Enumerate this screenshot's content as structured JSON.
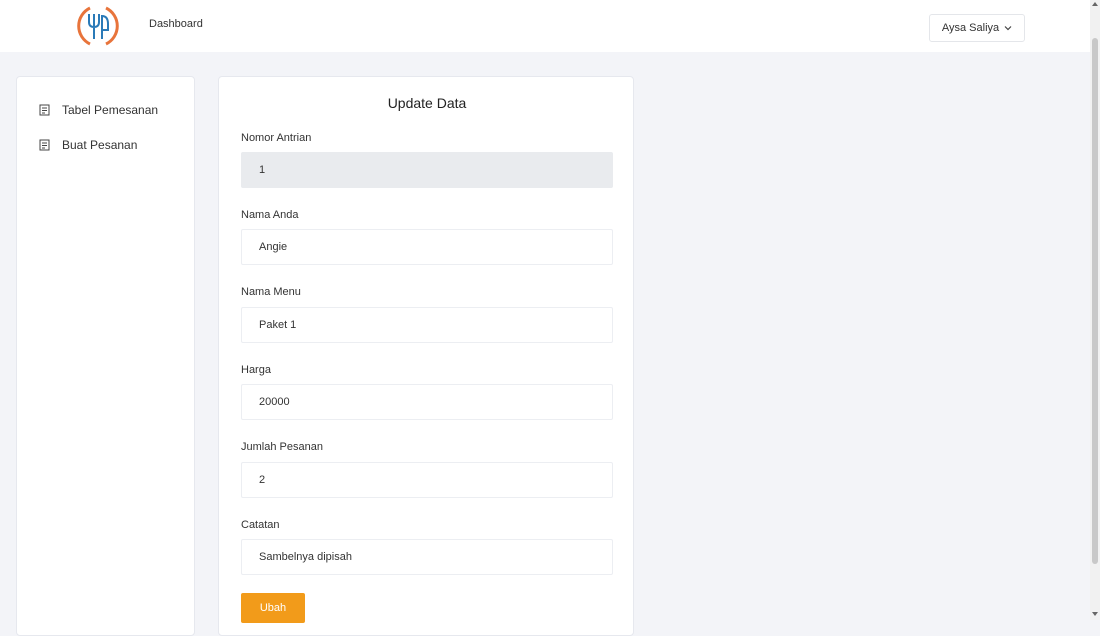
{
  "header": {
    "logo_icon": "fork-knife-logo-icon",
    "nav_dashboard": "Dashboard",
    "user_name": "Aysa Saliya",
    "user_menu_icon": "chevron-down-icon"
  },
  "sidebar": {
    "items": [
      {
        "label": "Tabel Pemesanan",
        "icon": "receipt-icon"
      },
      {
        "label": "Buat Pesanan",
        "icon": "receipt-icon"
      }
    ]
  },
  "form": {
    "title": "Update Data",
    "fields": [
      {
        "label": "Nomor Antrian",
        "value": "1",
        "readonly": true
      },
      {
        "label": "Nama Anda",
        "value": "Angie",
        "readonly": false
      },
      {
        "label": "Nama Menu",
        "value": "Paket 1",
        "readonly": false
      },
      {
        "label": "Harga",
        "value": "20000",
        "readonly": false
      },
      {
        "label": "Jumlah Pesanan",
        "value": "2",
        "readonly": false
      },
      {
        "label": "Catatan",
        "value": "Sambelnya dipisah",
        "readonly": false
      }
    ],
    "submit_label": "Ubah"
  },
  "colors": {
    "accent": "#f29b1a",
    "logo": "#e8743b",
    "background": "#f3f4f8"
  }
}
